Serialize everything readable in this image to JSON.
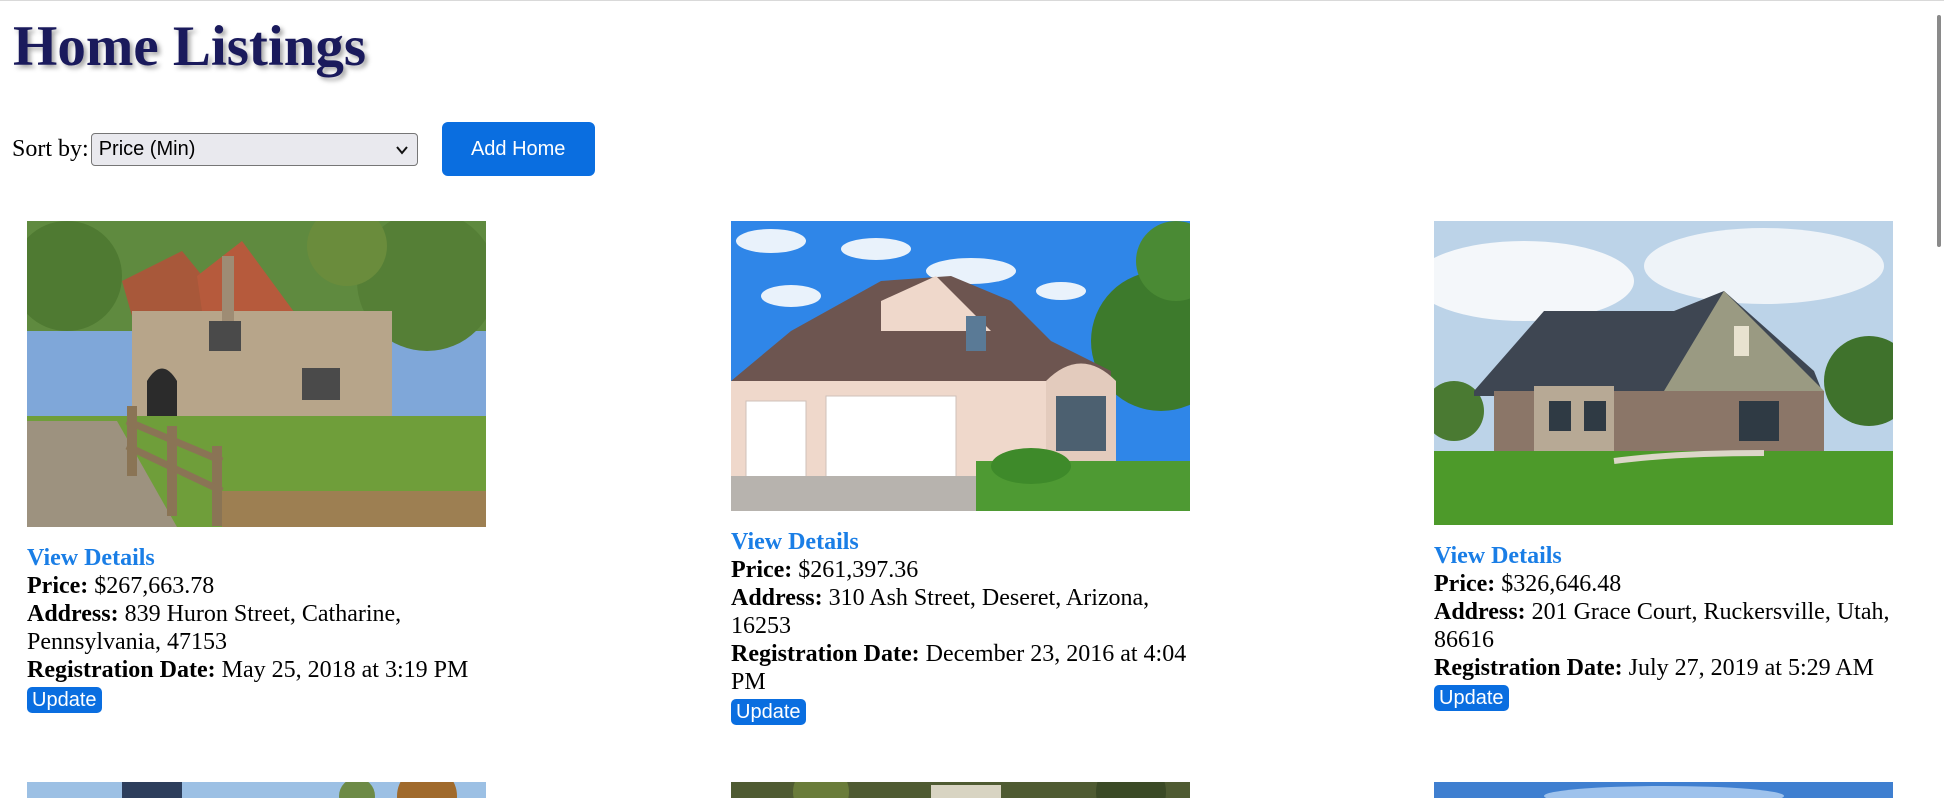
{
  "header": {
    "title": "Home Listings"
  },
  "controls": {
    "sort_label": "Sort by:",
    "sort_selected": "Price (Min)",
    "add_home_label": "Add Home"
  },
  "listings": [
    {
      "view_details_label": "View Details",
      "price_label": "Price:",
      "price": "$267,663.78",
      "address_label": "Address:",
      "address": "839 Huron Street, Catharine, Pennsylvania, 47153",
      "registration_label": "Registration Date:",
      "registration_date": "May 25, 2018 at 3:19 PM",
      "update_label": "Update"
    },
    {
      "view_details_label": "View Details",
      "price_label": "Price:",
      "price": "$261,397.36",
      "address_label": "Address:",
      "address": "310 Ash Street, Deseret, Arizona, 16253",
      "registration_label": "Registration Date:",
      "registration_date": "December 23, 2016 at 4:04 PM",
      "update_label": "Update"
    },
    {
      "view_details_label": "View Details",
      "price_label": "Price:",
      "price": "$326,646.48",
      "address_label": "Address:",
      "address": "201 Grace Court, Ruckersville, Utah, 86616",
      "registration_label": "Registration Date:",
      "registration_date": "July 27, 2019 at 5:29 AM",
      "update_label": "Update"
    }
  ],
  "colors": {
    "title": "#1a1a5c",
    "link": "#1a7ee6",
    "button": "#0a6ee0"
  }
}
